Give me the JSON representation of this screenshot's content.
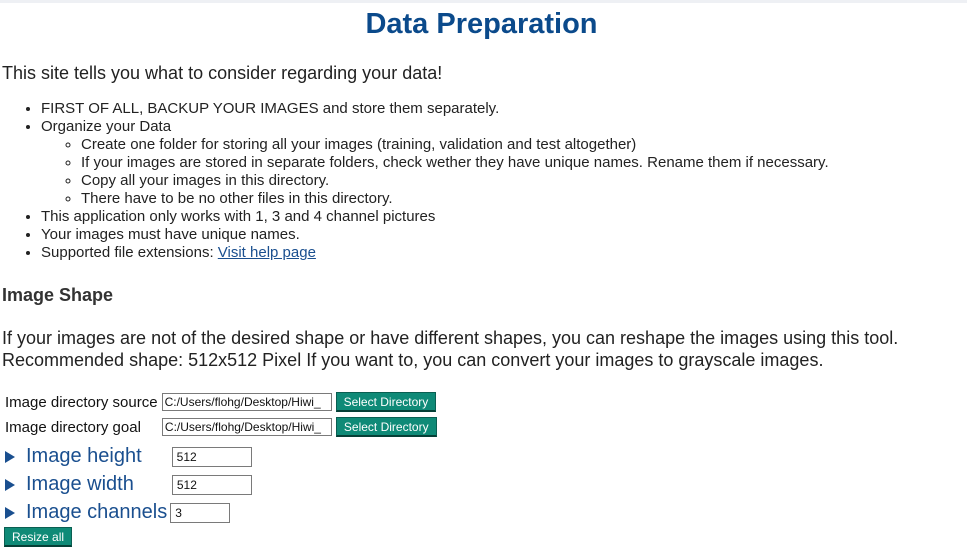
{
  "page": {
    "title": "Data Preparation",
    "intro": "This site tells you what to consider regarding your data!"
  },
  "list": {
    "item1": "FIRST OF ALL, BACKUP YOUR IMAGES and store them separately.",
    "item2": "Organize your Data",
    "sub1": "Create one folder for storing all your images (training, validation and test altogether)",
    "sub2": "If your images are stored in separate folders, check wether they have unique names. Rename them if necessary.",
    "sub3": "Copy all your images in this directory.",
    "sub4": "There have to be no other files in this directory.",
    "item3": "This application only works with 1, 3 and 4 channel pictures",
    "item4": "Your images must have unique names.",
    "item5_prefix": "Supported file extensions: ",
    "item5_link": "Visit help page"
  },
  "section": {
    "title": "Image Shape",
    "desc_line1": "If your images are not of the desired shape or have different shapes, you can reshape the images using this tool.",
    "desc_line2": "Recommended shape: 512x512 Pixel If you want to, you can convert your images to grayscale images."
  },
  "form": {
    "source_label": "Image directory source",
    "source_value": "C:/Users/flohg/Desktop/Hiwi_",
    "goal_label": "Image directory goal",
    "goal_value": "C:/Users/flohg/Desktop/Hiwi_",
    "select_button": "Select Directory",
    "height_label": "Image height",
    "height_value": "512",
    "width_label": "Image width",
    "width_value": "512",
    "channels_label": "Image channels",
    "channels_value": "3",
    "resize_button": "Resize all"
  },
  "colors": {
    "title": "#0b4a8b",
    "button": "#0f8a77",
    "link": "#1a4f8f"
  },
  "icons": {
    "expand": "triangle-right-icon"
  }
}
